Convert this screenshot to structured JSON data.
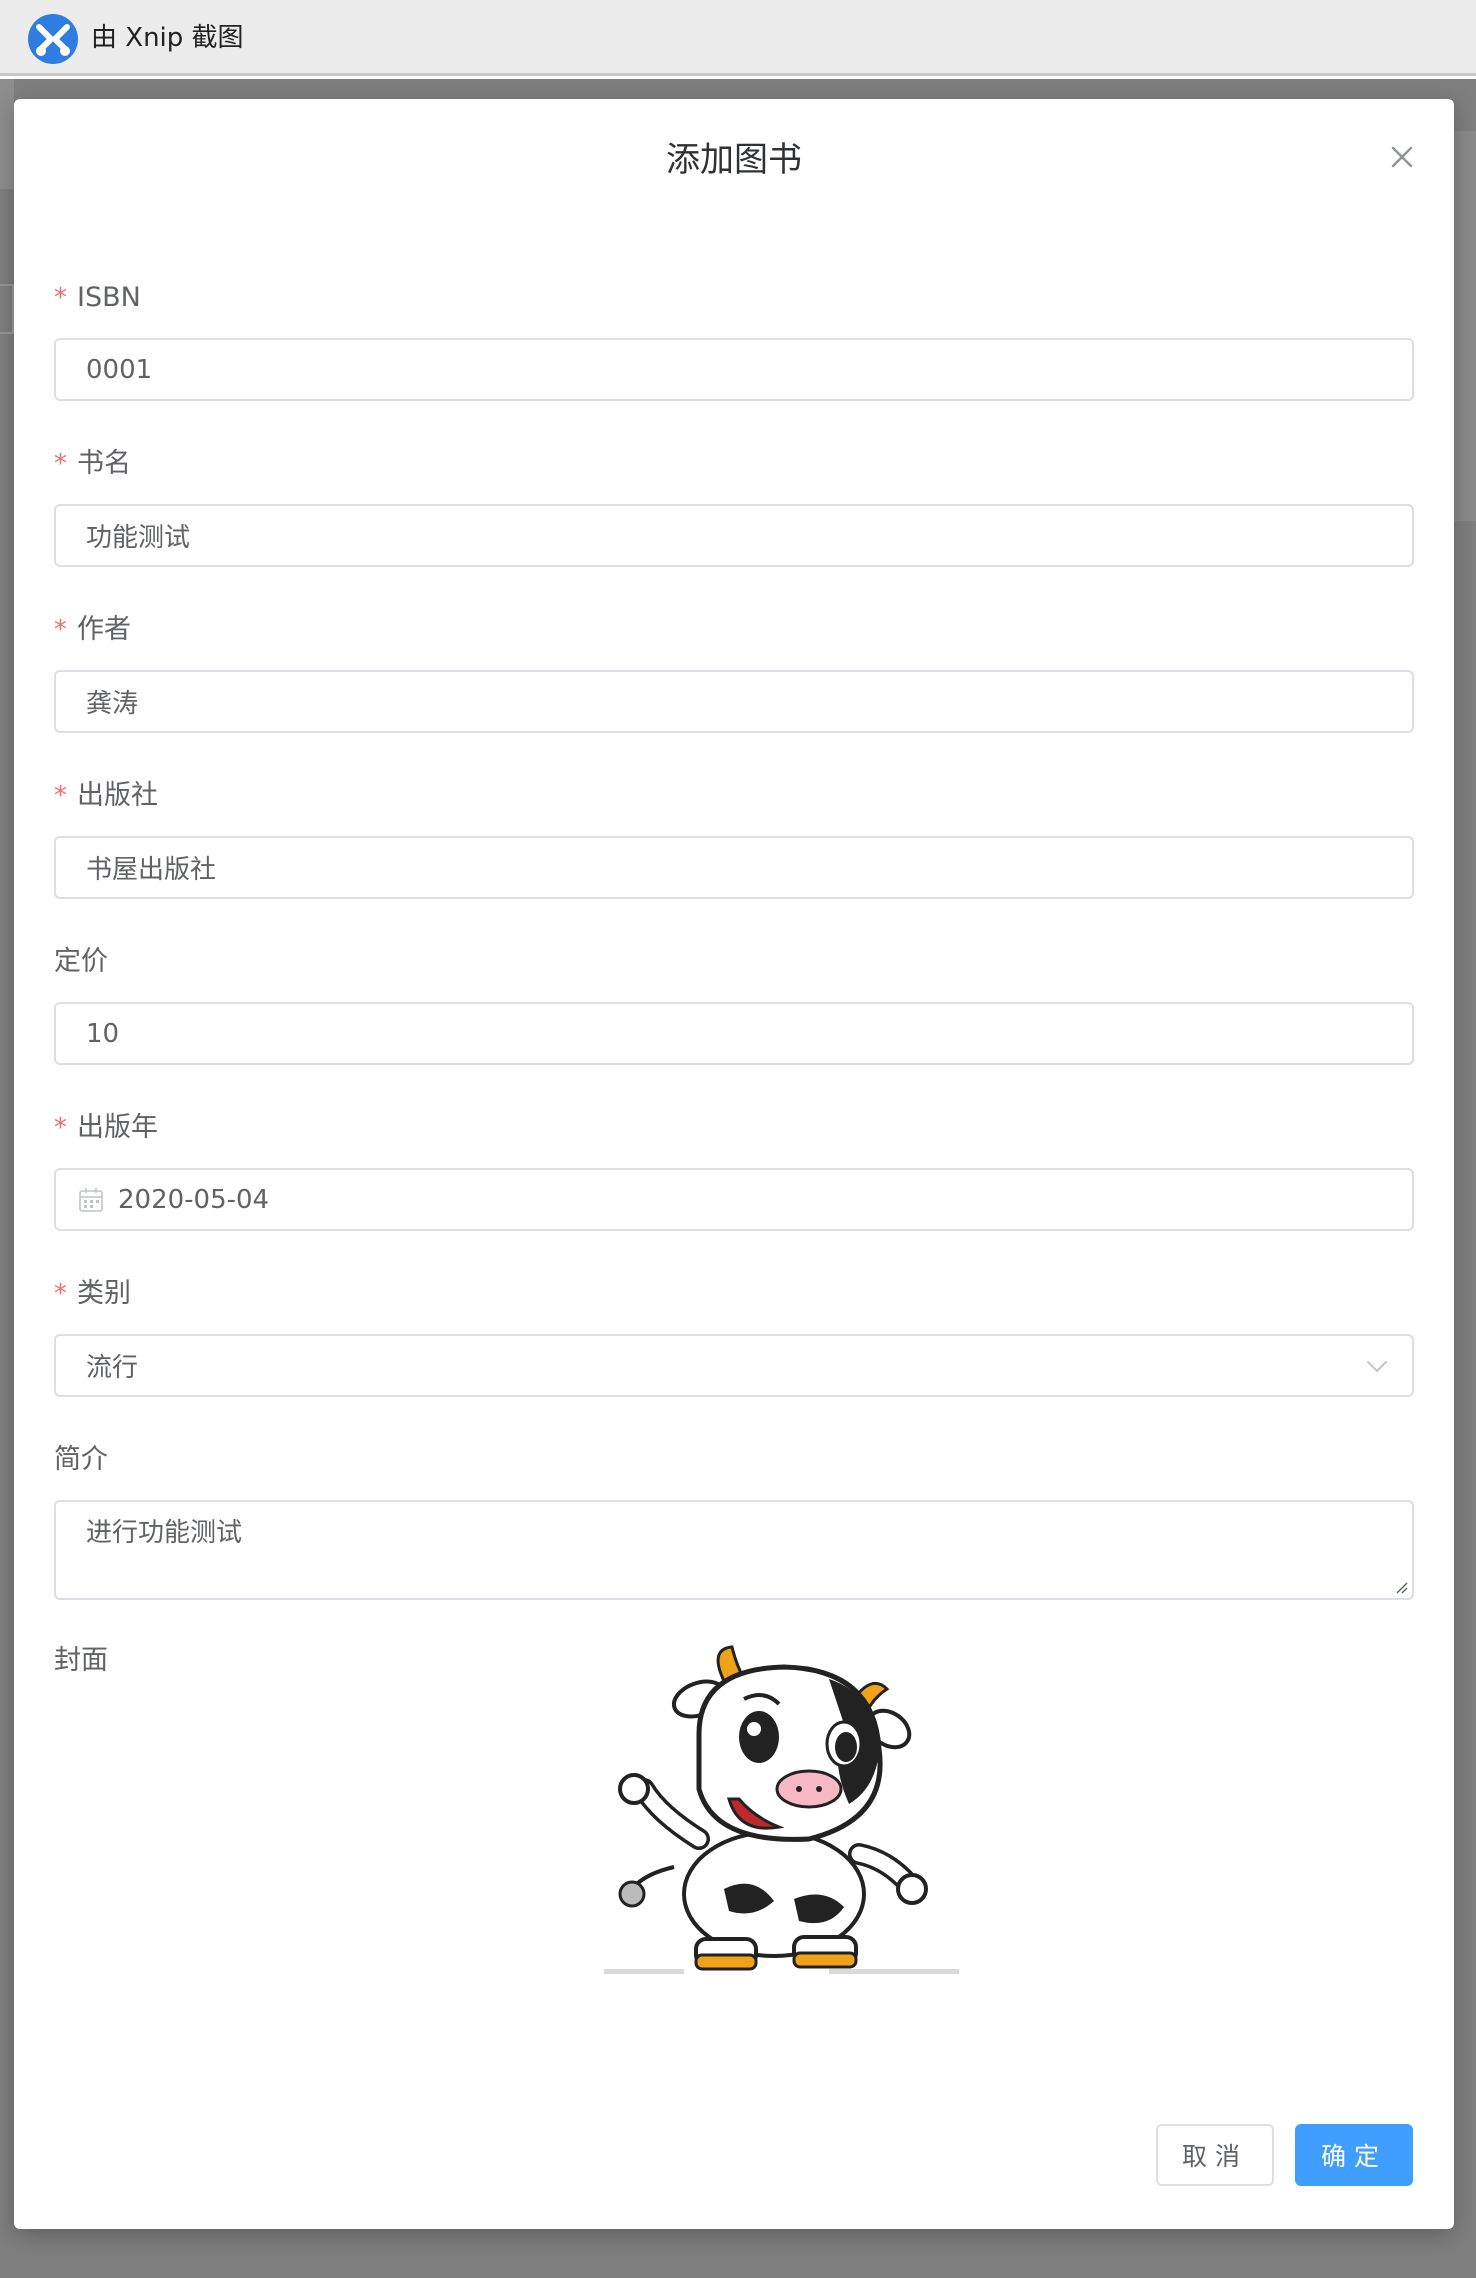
{
  "app": {
    "title": "由 Xnip 截图",
    "icon": "xnip-logo-icon",
    "brand_color": "#2f7de1"
  },
  "dialog": {
    "title": "添加图书",
    "close_icon": "close-icon"
  },
  "form": {
    "required_marker": "*",
    "isbn": {
      "label": "ISBN",
      "value": "0001",
      "required": true
    },
    "title": {
      "label": "书名",
      "value": "功能测试",
      "required": true
    },
    "author": {
      "label": "作者",
      "value": "龚涛",
      "required": true
    },
    "publisher": {
      "label": "出版社",
      "value": "书屋出版社",
      "required": true
    },
    "price": {
      "label": "定价",
      "value": "10",
      "required": false
    },
    "publish_year": {
      "label": "出版年",
      "value": "2020-05-04",
      "required": true,
      "icon": "calendar-icon"
    },
    "category": {
      "label": "类别",
      "value": "流行",
      "required": true,
      "icon": "chevron-down-icon"
    },
    "summary": {
      "label": "简介",
      "value": "进行功能测试",
      "required": false
    },
    "cover": {
      "label": "封面",
      "image": "cartoon-cow-image"
    }
  },
  "footer": {
    "cancel_label": "取消",
    "confirm_label": "确定"
  },
  "colors": {
    "primary": "#409eff",
    "required": "#f56c6c",
    "border": "#dcdfe6",
    "text": "#606266",
    "overlay": "#7f7f7f"
  }
}
